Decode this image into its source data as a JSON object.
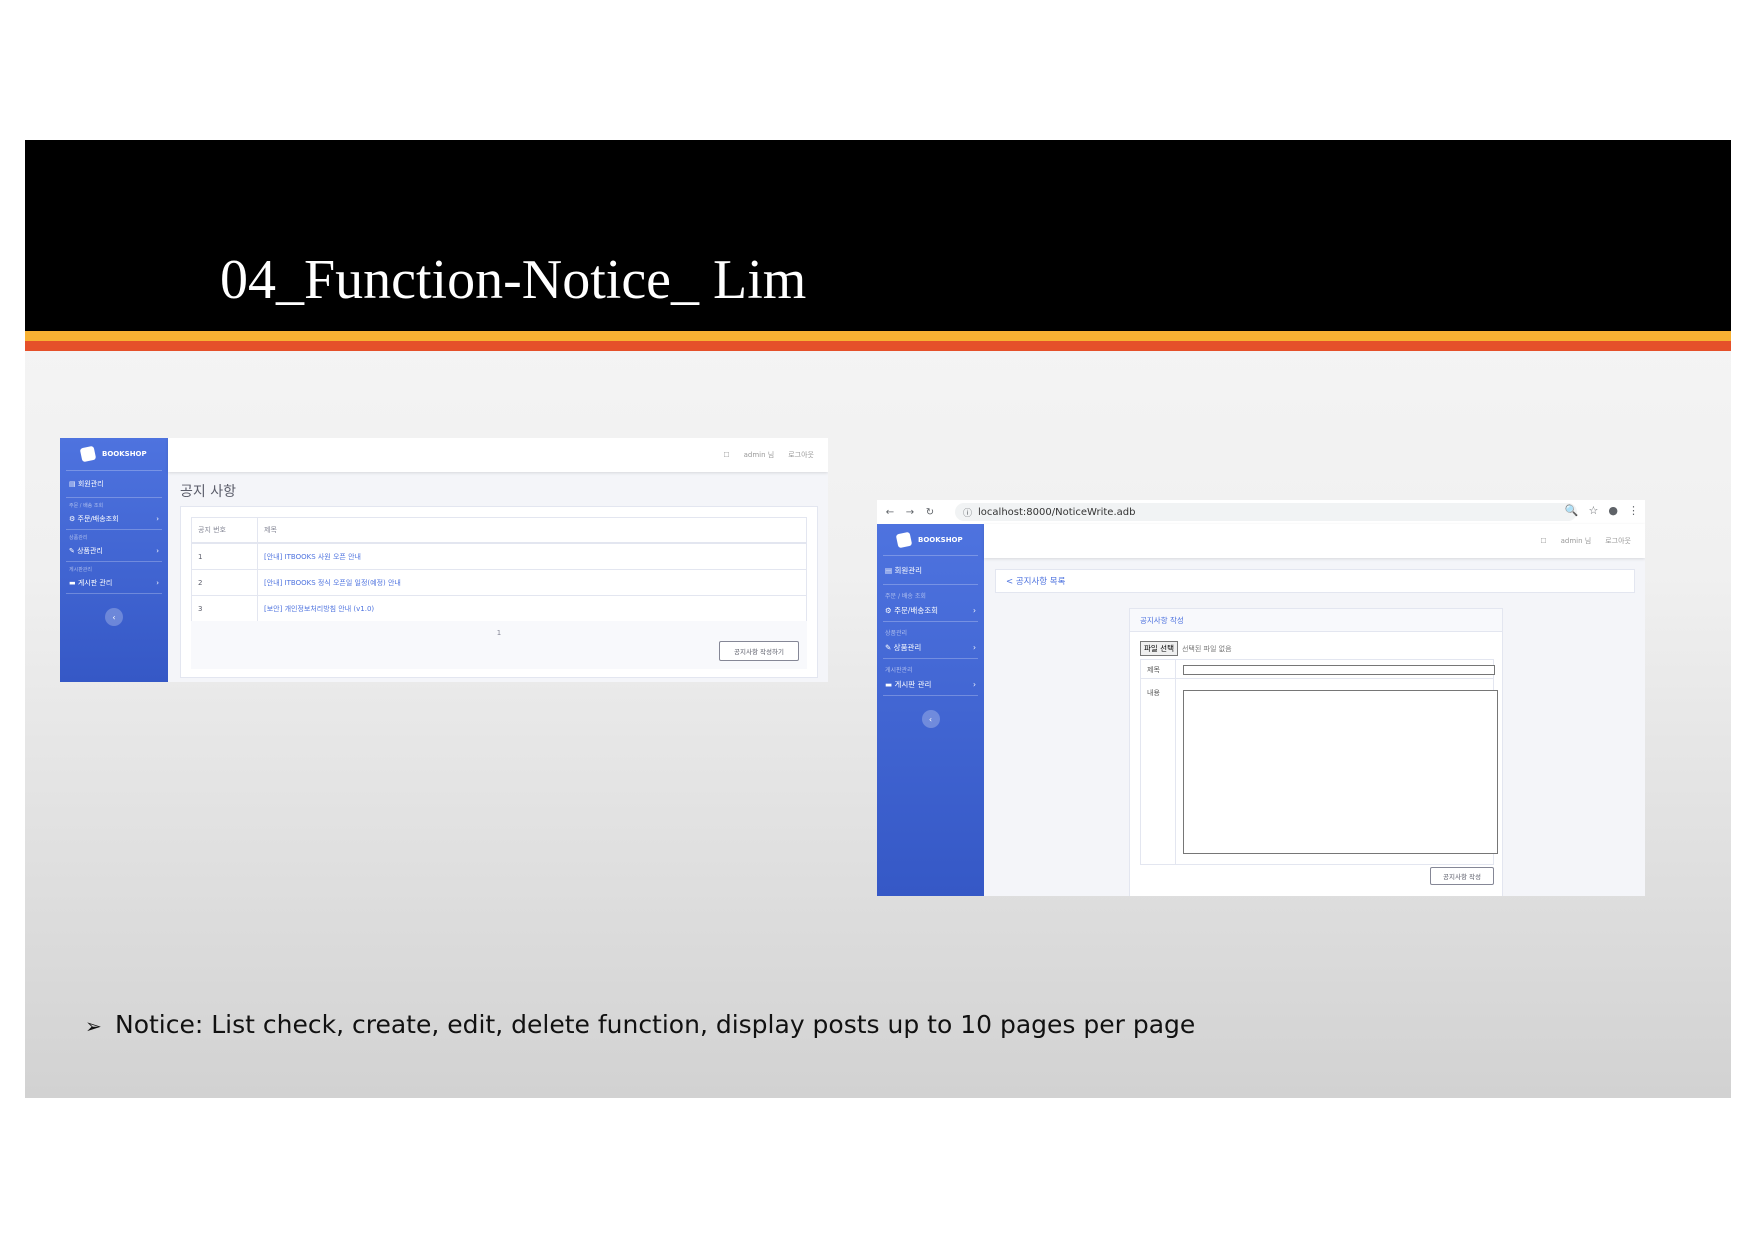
{
  "slide": {
    "title": "04_Function-Notice_ Lim",
    "bullet_symbol": "➢",
    "bullet": "Notice: List check, create, edit, delete function, display posts up to 10 pages per page"
  },
  "shot1": {
    "brand": "BOOKSHOP",
    "sidebar": {
      "item_members": "회원관리",
      "head_orders": "주문 / 배송 조회",
      "item_orders": "주문/배송조회",
      "head_products": "상품관리",
      "item_products": "상품관리",
      "head_board": "게시판관리",
      "item_board": "게시판 관리",
      "toggle": "‹"
    },
    "topbar": {
      "bell": "☐",
      "user": "admin 님",
      "logout": "로그아웃"
    },
    "page_title": "공지 사항",
    "table": {
      "col_num": "공지 번호",
      "col_title": "제목",
      "rows": [
        {
          "num": "1",
          "title": "[안내] ITBOOKS 사원 오픈 안내"
        },
        {
          "num": "2",
          "title": "[안내] ITBOOKS 정식 오픈일 일정(예정) 안내"
        },
        {
          "num": "3",
          "title": "[보안] 개인정보처리방침 안내 (v1.0)"
        }
      ]
    },
    "pager": "1",
    "write_button": "공지사항 작성하기"
  },
  "shot2": {
    "browser": {
      "back": "←",
      "forward": "→",
      "reload": "↻",
      "info": "ⓘ",
      "url": "localhost:8000/NoticeWrite.adb",
      "zoom": "🔍",
      "star": "☆",
      "account": "●",
      "menu": "⋮"
    },
    "brand": "BOOKSHOP",
    "sidebar": {
      "item_members": "회원관리",
      "head_orders": "주문 / 배송 조회",
      "item_orders": "주문/배송조회",
      "head_products": "상품관리",
      "item_products": "상품관리",
      "head_board": "게시판관리",
      "item_board": "게시판 관리",
      "toggle": "‹"
    },
    "topbar": {
      "bell": "☐",
      "user": "admin 님",
      "logout": "로그아웃"
    },
    "back_link": "< 공지사항 목록",
    "form": {
      "header": "공지사항 작성",
      "file_button": "파일 선택",
      "file_status": "선택된 파일 없음",
      "label_title": "제목",
      "label_content": "내용",
      "submit": "공지사항 작성"
    }
  }
}
